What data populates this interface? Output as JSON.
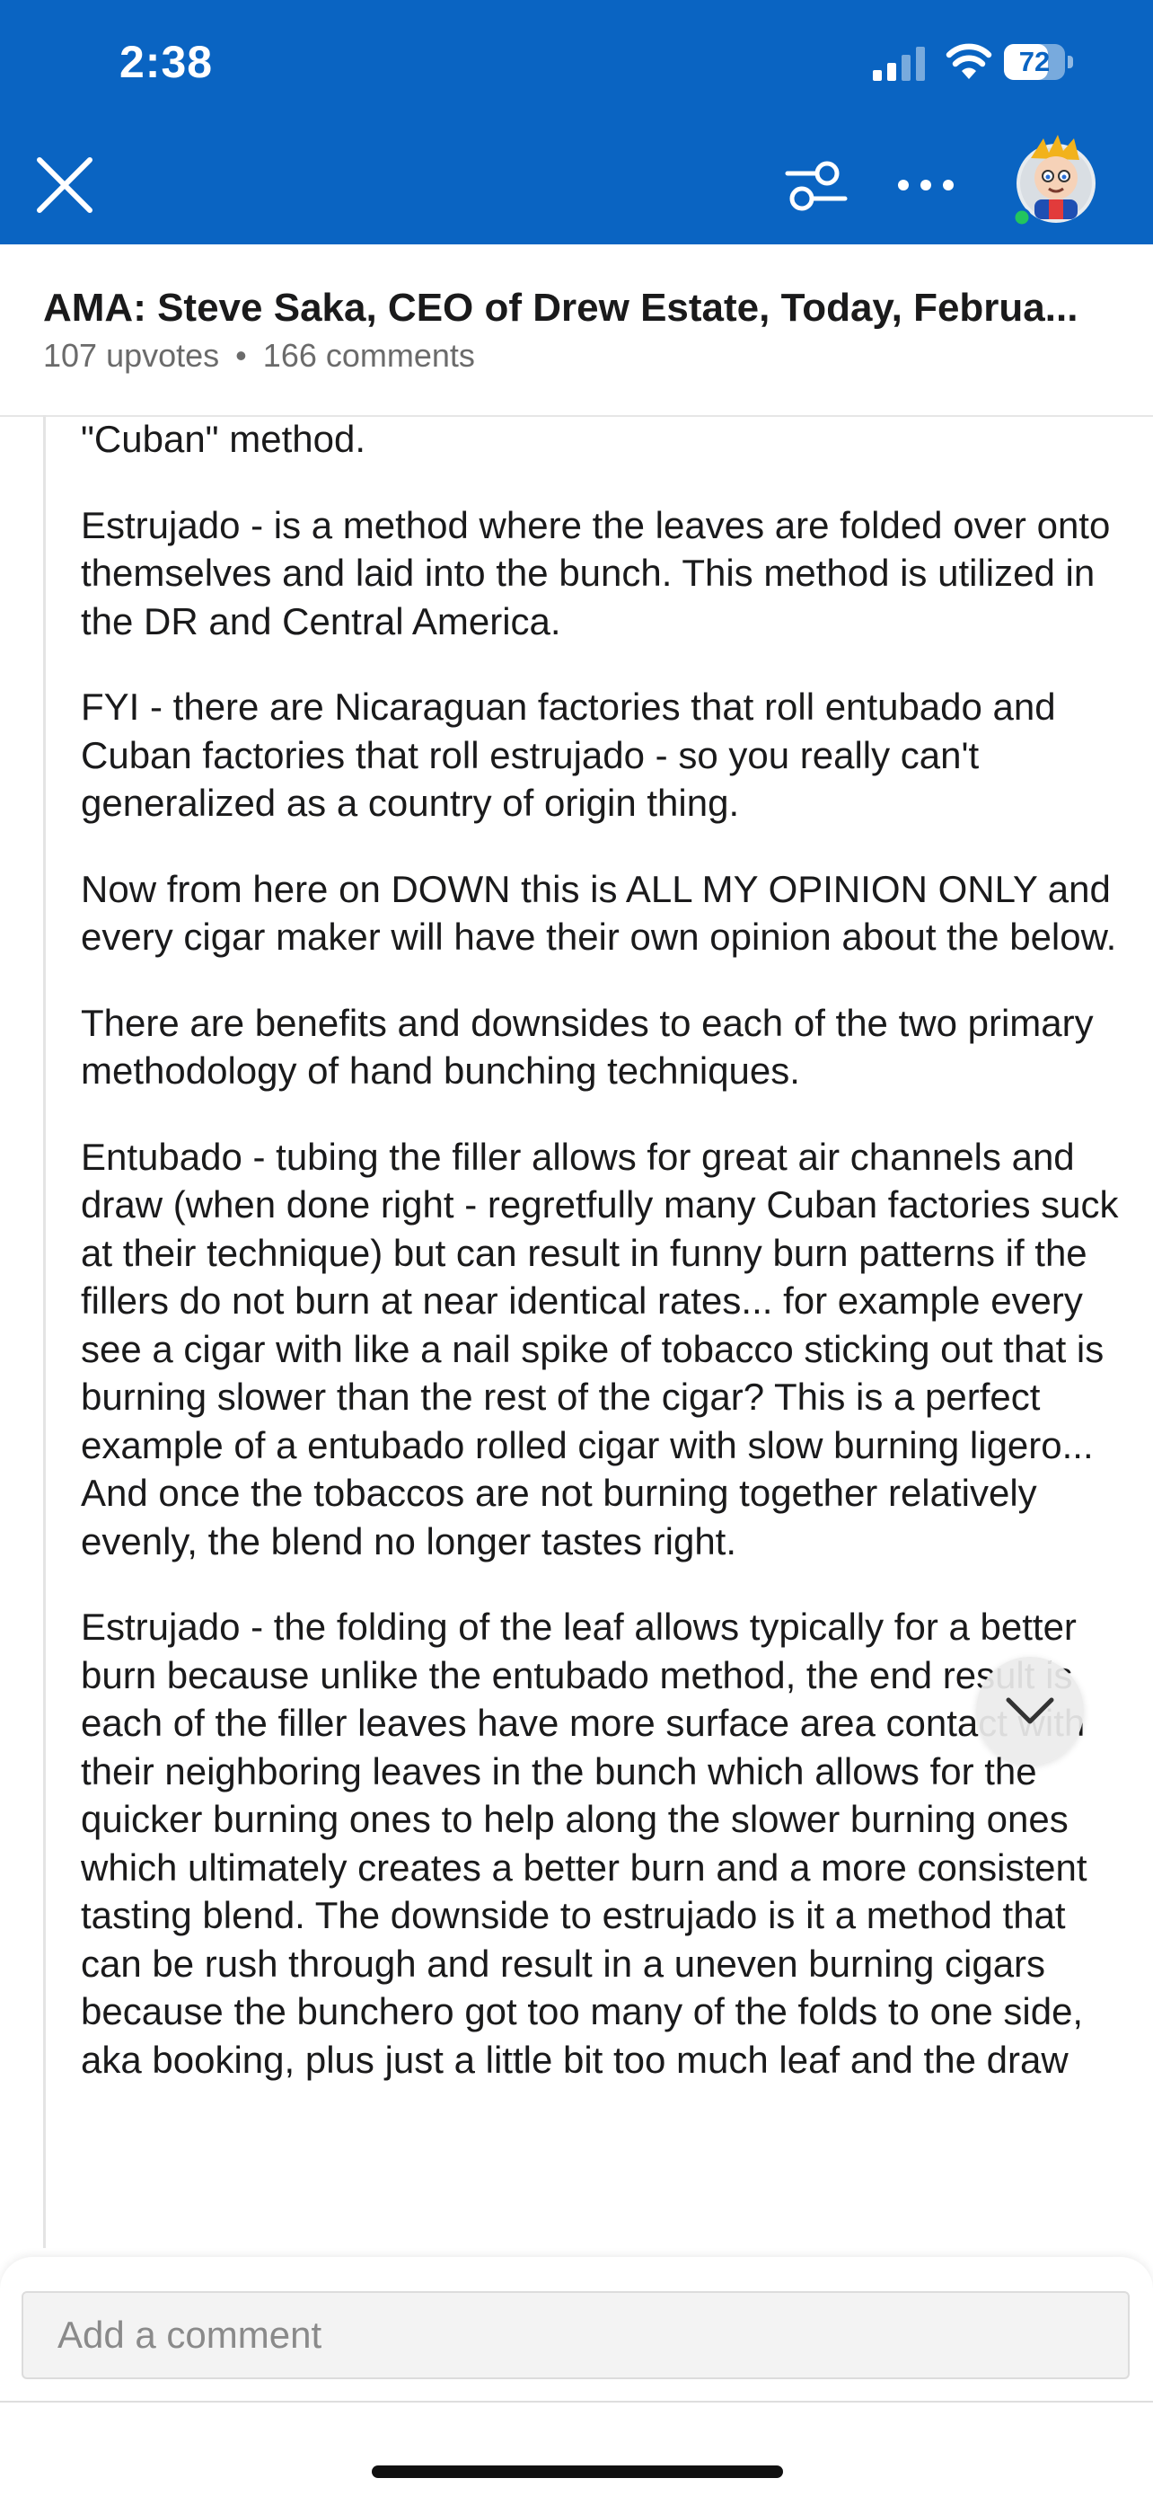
{
  "status_bar": {
    "time": "2:38",
    "battery": "72",
    "battery_level": 0.72
  },
  "header": {
    "close_icon": "close-icon",
    "filter_icon": "sort-filter-icon",
    "more_icon": "more-icon",
    "avatar_icon": "astronaut-avatar",
    "accent_color": "#0a64c2",
    "online_color": "#22c55e"
  },
  "post": {
    "title": "AMA: Steve Saka, CEO of Drew Estate, Today, Februa...",
    "upvotes": "107 upvotes",
    "separator": "•",
    "comments": "166 comments"
  },
  "comment": {
    "paragraphs": [
      "\"Cuban\" method.",
      "Estrujado - is a method where the leaves are folded over onto themselves and laid into the bunch. This method is utilized in the DR and Central America.",
      "FYI - there are Nicaraguan factories that roll entubado and Cuban factories that roll estrujado - so you really can't generalized as a country of origin thing.",
      "Now from here on DOWN this is ALL MY OPINION ONLY and every cigar maker will have their own opinion about the below.",
      "There are benefits and downsides to each of the two primary methodology of hand bunching techniques.",
      "Entubado - tubing the filler allows for great air channels and draw (when done right - regretfully many Cuban factories suck at their technique) but can result in funny burn patterns if the fillers do not burn at near identical rates... for example every see a cigar with like a nail spike of tobacco sticking out that is burning slower than the rest of the cigar? This is a perfect example of a entubado rolled cigar with slow burning ligero... And once the tobaccos are not burning together relatively evenly, the blend no longer tastes right.",
      "Estrujado - the folding of the leaf allows typically for a better burn because unlike the entubado method, the end result is each of the filler leaves have more surface area contact with their neighboring leaves in the bunch which allows for the quicker burning ones to help along the slower burning ones which ultimately creates a better burn and a more consistent tasting blend. The downside to estrujado is it a method that can be rush through and result in a uneven burning cigars because the bunchero got too many of the folds to one side, aka booking, plus just a little bit too much leaf and the draw"
    ]
  },
  "scroll_button": {
    "icon": "chevron-down-icon"
  },
  "composer": {
    "placeholder": "Add a comment"
  }
}
